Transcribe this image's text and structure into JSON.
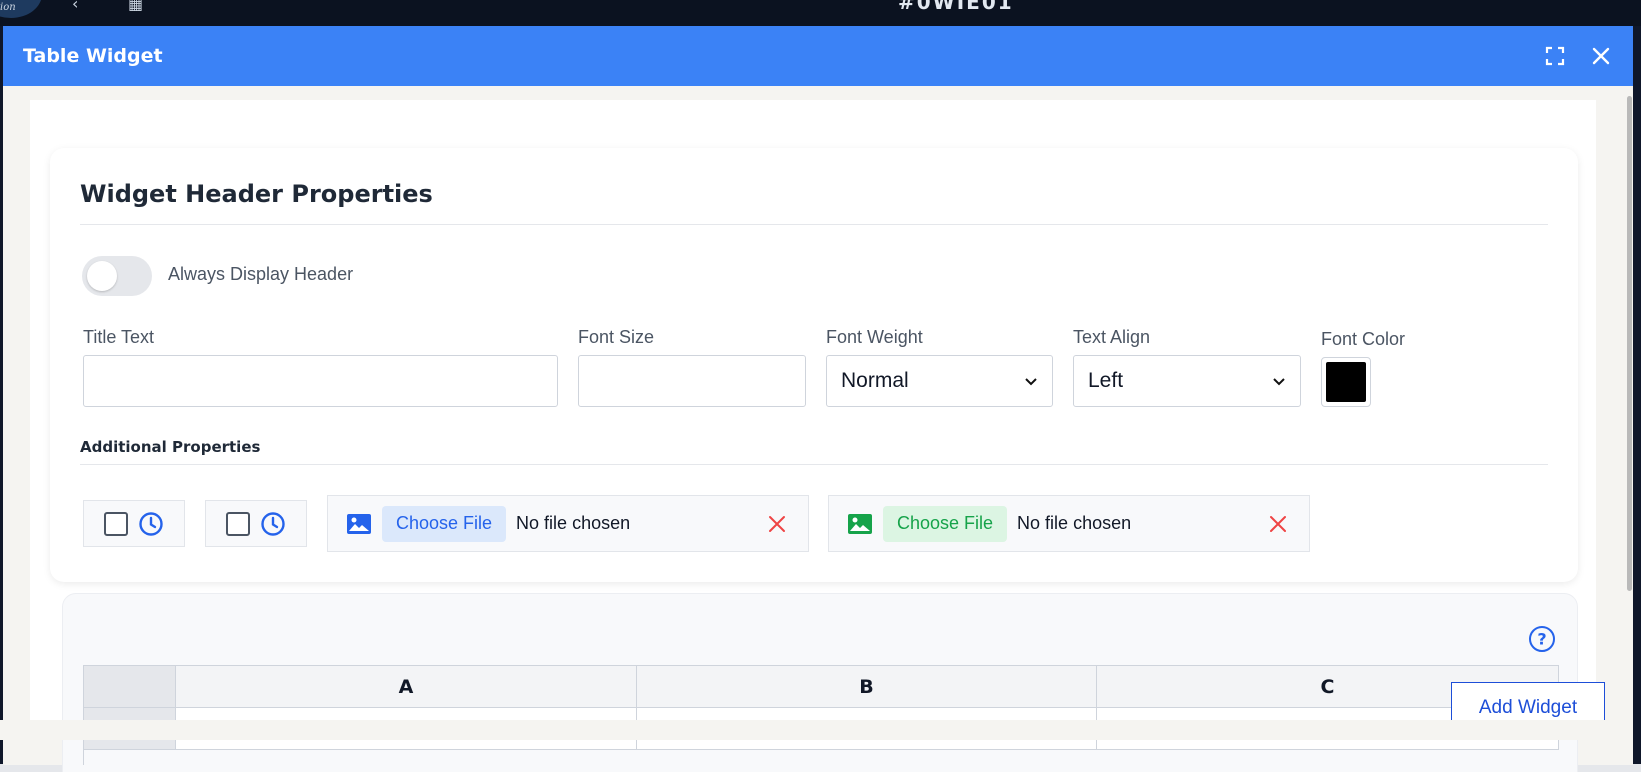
{
  "background": {
    "logo_text": "ion",
    "title": "#0WIE01"
  },
  "modal": {
    "title": "Table Widget"
  },
  "header_properties": {
    "title": "Widget Header Properties",
    "toggle_label": "Always Display Header",
    "toggle_on": false,
    "title_text_label": "Title Text",
    "title_text_value": "",
    "font_size_label": "Font Size",
    "font_size_value": "",
    "font_weight_label": "Font Weight",
    "font_weight_value": "Normal",
    "text_align_label": "Text Align",
    "text_align_value": "Left",
    "font_color_label": "Font Color",
    "font_color_value": "#000000"
  },
  "additional": {
    "title": "Additional Properties",
    "file1": {
      "button": "Choose File",
      "status": "No file chosen",
      "accent": "#2563eb",
      "button_bg": "#dbe8fb"
    },
    "file2": {
      "button": "Choose File",
      "status": "No file chosen",
      "accent": "#16a34a",
      "button_bg": "#dcf5e3"
    }
  },
  "table": {
    "columns": [
      "A",
      "B",
      "C"
    ]
  },
  "actions": {
    "add_widget": "Add Widget"
  },
  "colors": {
    "header_blue": "#3b82f6",
    "clock_blue": "#2563eb",
    "clear_red": "#ef4444"
  }
}
